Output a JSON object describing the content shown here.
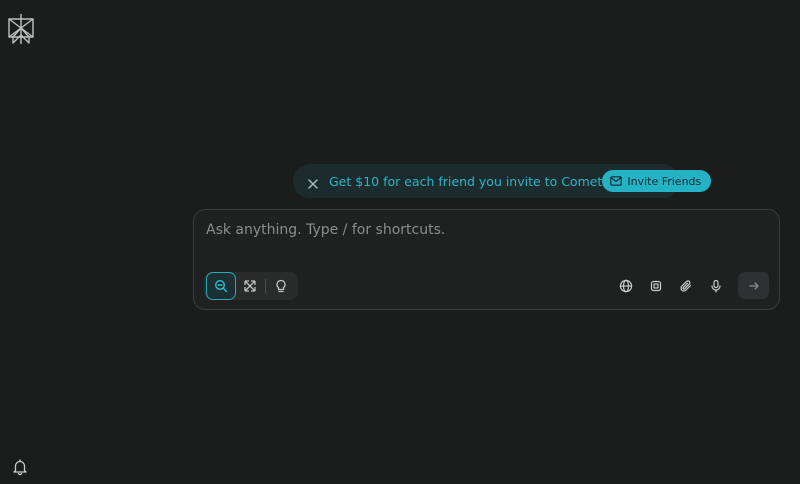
{
  "icons": {
    "logo": "perplexity-logo",
    "bell": "bell-icon",
    "close": "close-icon",
    "mail": "mail-icon",
    "search_mode": "search-icon",
    "research_mode": "research-icon",
    "labs_mode": "lightbulb-icon",
    "globe": "globe-icon",
    "cpu": "cpu-icon",
    "attach": "paperclip-icon",
    "mic": "microphone-icon",
    "send": "arrow-right-icon"
  },
  "banner": {
    "text": "Get $10 for each friend you invite to Comet",
    "button_label": "Invite Friends"
  },
  "composer": {
    "placeholder": "Ask anything. Type / for shortcuts."
  },
  "colors": {
    "background": "#1b1c1c",
    "accent": "#23b3c4",
    "banner_bg": "#1c2c2e"
  }
}
